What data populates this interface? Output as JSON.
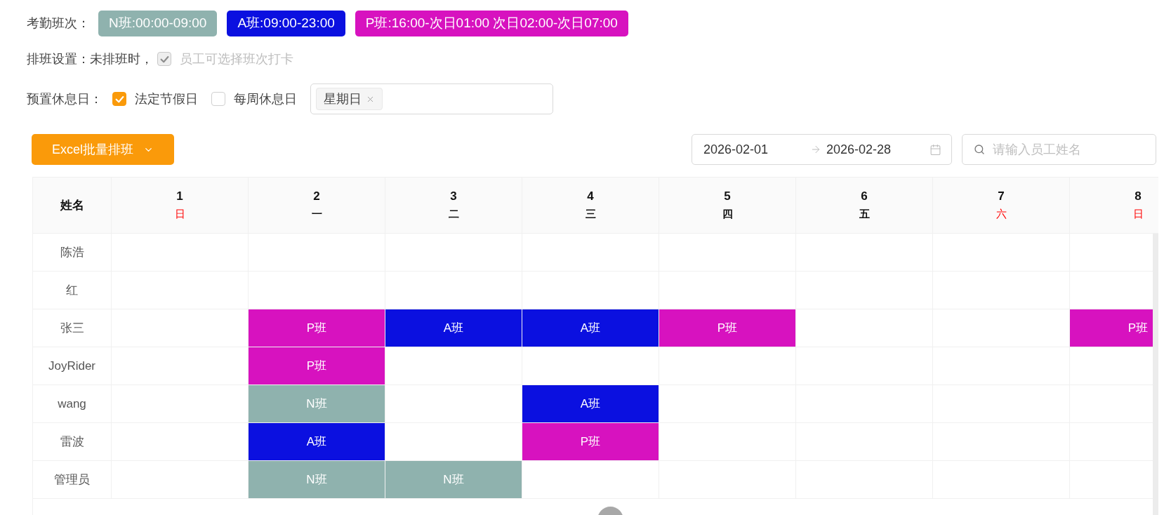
{
  "shift_legend": {
    "label": "考勤班次：",
    "shifts": [
      {
        "label": "N班:00:00-09:00",
        "color": "#8fb2ae"
      },
      {
        "label": "A班:09:00-23:00",
        "color": "#0b10e0"
      },
      {
        "label": "P班:16:00-次日01:00 次日02:00-次日07:00",
        "color": "#d712bf"
      }
    ]
  },
  "schedule_setting": {
    "label": "排班设置：",
    "prefix": "未排班时，",
    "option": {
      "label": "员工可选择班次打卡",
      "checked": true,
      "disabled": true
    }
  },
  "rest_days": {
    "label": "预置休息日：",
    "options": [
      {
        "label": "法定节假日",
        "checked": true
      },
      {
        "label": "每周休息日",
        "checked": false
      }
    ],
    "weekday_tags": [
      "星期日"
    ]
  },
  "toolbar": {
    "batch_button": "Excel批量排班",
    "date_range": {
      "start": "2026-02-01",
      "end": "2026-02-28"
    },
    "search": {
      "placeholder": "请输入员工姓名"
    }
  },
  "table": {
    "name_header": "姓名",
    "days": [
      {
        "day": "1",
        "weekday": "日",
        "weekend": true
      },
      {
        "day": "2",
        "weekday": "一",
        "weekend": false
      },
      {
        "day": "3",
        "weekday": "二",
        "weekend": false
      },
      {
        "day": "4",
        "weekday": "三",
        "weekend": false
      },
      {
        "day": "5",
        "weekday": "四",
        "weekend": false
      },
      {
        "day": "6",
        "weekday": "五",
        "weekend": false
      },
      {
        "day": "7",
        "weekday": "六",
        "weekend": true
      },
      {
        "day": "8",
        "weekday": "日",
        "weekend": true
      }
    ],
    "rows": [
      {
        "name": "陈浩",
        "cells": [
          {
            "kind": "empty"
          },
          {
            "kind": "empty"
          },
          {
            "kind": "empty"
          },
          {
            "kind": "empty"
          },
          {
            "kind": "empty"
          },
          {
            "kind": "empty"
          },
          {
            "kind": "empty"
          },
          {
            "kind": "empty"
          }
        ]
      },
      {
        "name": "红",
        "cells": [
          {
            "kind": "empty"
          },
          {
            "kind": "empty"
          },
          {
            "kind": "empty"
          },
          {
            "kind": "empty"
          },
          {
            "kind": "empty"
          },
          {
            "kind": "empty"
          },
          {
            "kind": "empty"
          },
          {
            "kind": "empty"
          }
        ]
      },
      {
        "name": "张三",
        "cells": [
          {
            "kind": "empty"
          },
          {
            "kind": "shift",
            "label": "P班",
            "color": "#d712bf"
          },
          {
            "kind": "shift",
            "label": "A班",
            "color": "#0b10e0"
          },
          {
            "kind": "shift",
            "label": "A班",
            "color": "#0b10e0"
          },
          {
            "kind": "shift",
            "label": "P班",
            "color": "#d712bf"
          },
          {
            "kind": "empty"
          },
          {
            "kind": "empty"
          },
          {
            "kind": "shift",
            "label": "P班",
            "color": "#d712bf"
          }
        ]
      },
      {
        "name": "JoyRider",
        "cells": [
          {
            "kind": "empty"
          },
          {
            "kind": "shift",
            "label": "P班",
            "color": "#d712bf"
          },
          {
            "kind": "empty"
          },
          {
            "kind": "empty"
          },
          {
            "kind": "empty"
          },
          {
            "kind": "empty"
          },
          {
            "kind": "empty"
          },
          {
            "kind": "empty"
          }
        ]
      },
      {
        "name": "wang",
        "cells": [
          {
            "kind": "empty"
          },
          {
            "kind": "shift",
            "label": "N班",
            "color": "#8fb2ae"
          },
          {
            "kind": "empty"
          },
          {
            "kind": "shift",
            "label": "A班",
            "color": "#0b10e0"
          },
          {
            "kind": "empty"
          },
          {
            "kind": "empty"
          },
          {
            "kind": "empty"
          },
          {
            "kind": "empty"
          }
        ]
      },
      {
        "name": "雷波",
        "cells": [
          {
            "kind": "empty"
          },
          {
            "kind": "shift",
            "label": "A班",
            "color": "#0b10e0"
          },
          {
            "kind": "empty"
          },
          {
            "kind": "shift",
            "label": "P班",
            "color": "#d712bf"
          },
          {
            "kind": "empty"
          },
          {
            "kind": "empty"
          },
          {
            "kind": "empty"
          },
          {
            "kind": "empty"
          }
        ]
      },
      {
        "name": "管理员",
        "cells": [
          {
            "kind": "empty"
          },
          {
            "kind": "shift",
            "label": "N班",
            "color": "#8fb2ae"
          },
          {
            "kind": "shift",
            "label": "N班",
            "color": "#8fb2ae"
          },
          {
            "kind": "empty"
          },
          {
            "kind": "empty"
          },
          {
            "kind": "empty"
          },
          {
            "kind": "empty"
          },
          {
            "kind": "empty"
          }
        ]
      }
    ]
  }
}
